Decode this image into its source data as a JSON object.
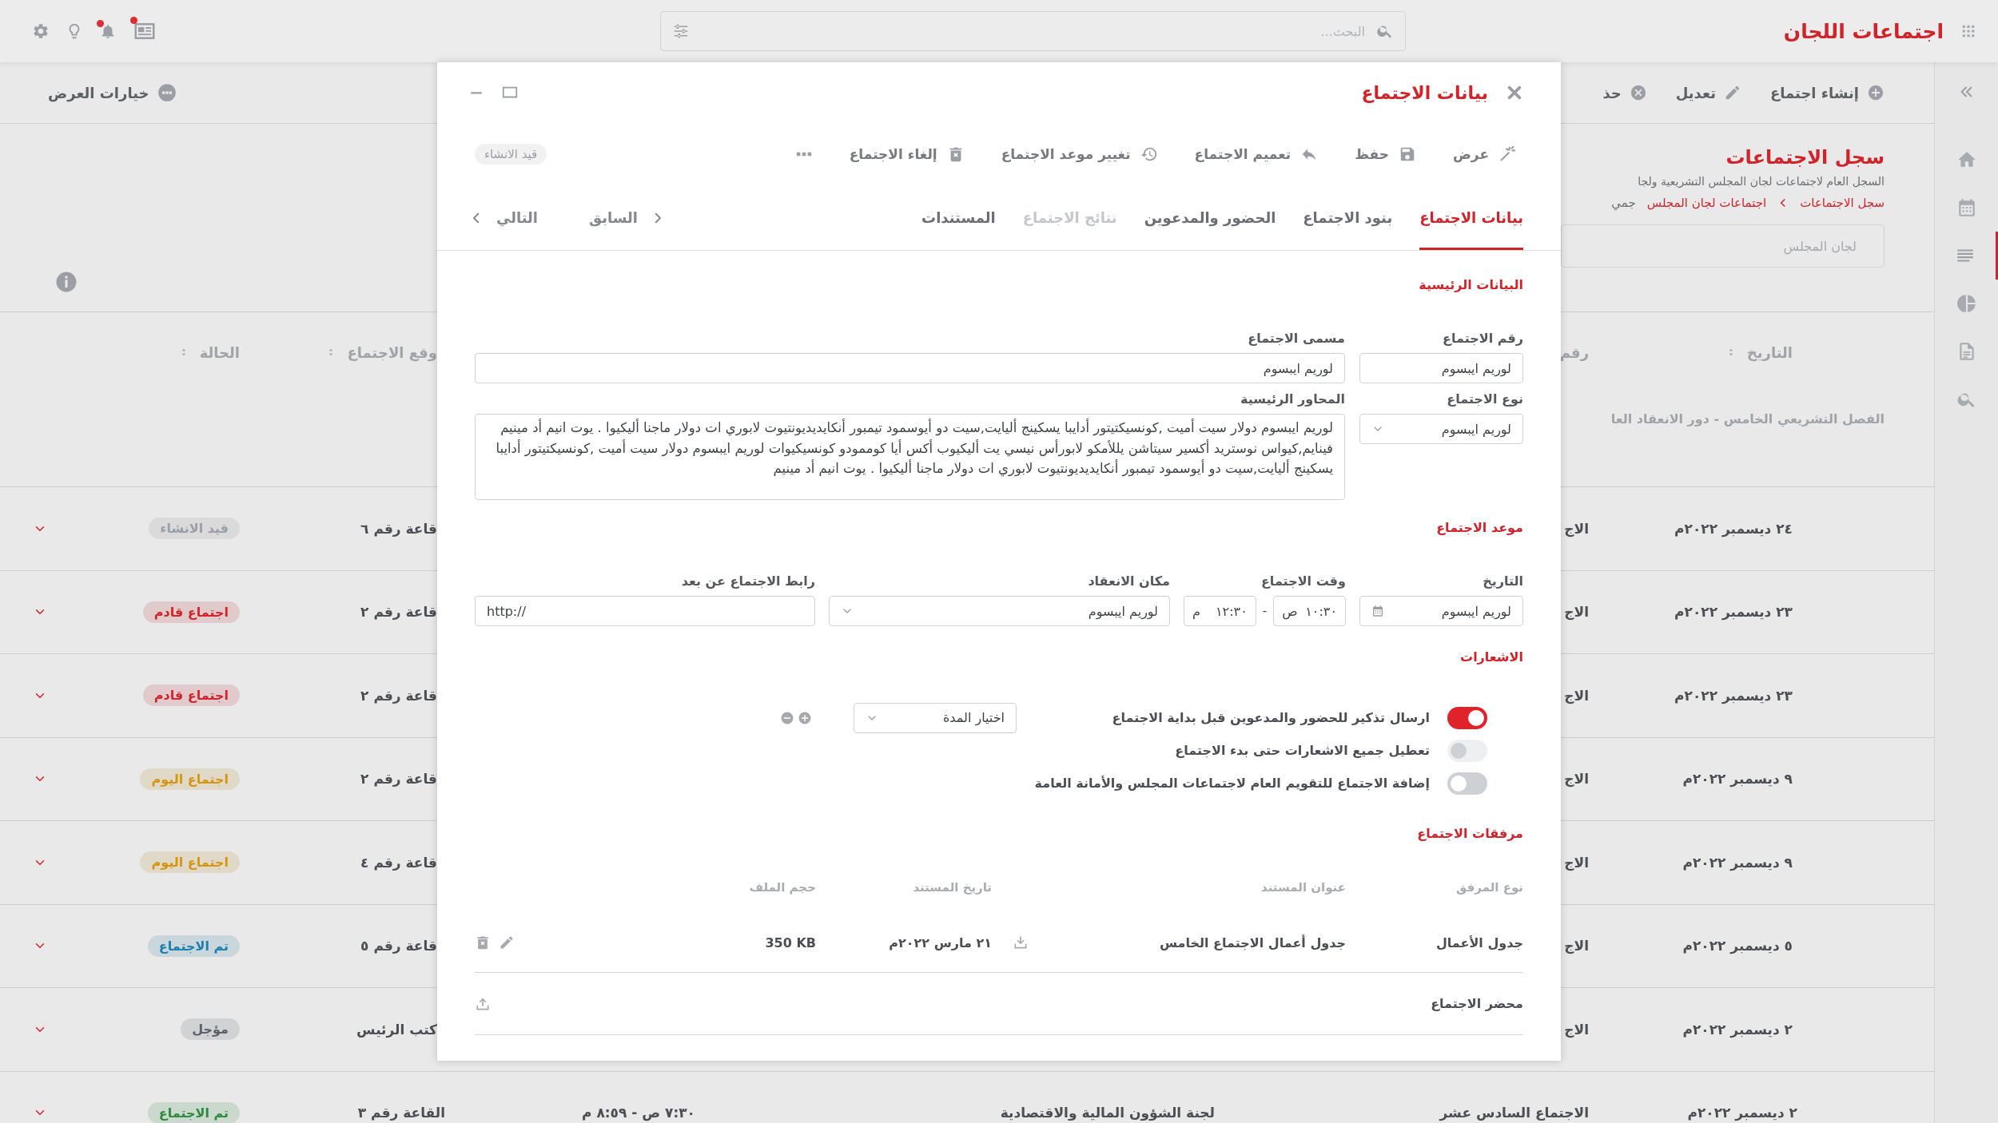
{
  "app": {
    "title": "اجتماعات اللجان"
  },
  "search": {
    "placeholder": "البحث..."
  },
  "top_icons": [
    {
      "kind": "news",
      "badge": true
    },
    {
      "kind": "bell",
      "badge": true
    },
    {
      "kind": "bulb",
      "badge": false
    },
    {
      "kind": "settings",
      "badge": false
    }
  ],
  "sidebar": {
    "items": [
      {
        "kind": "home",
        "selected": false
      },
      {
        "kind": "calendar",
        "selected": false
      },
      {
        "kind": "list",
        "selected": true
      },
      {
        "kind": "chart",
        "selected": false
      },
      {
        "kind": "document",
        "selected": false
      },
      {
        "kind": "search",
        "selected": false
      }
    ]
  },
  "toolbar": {
    "actions": [
      {
        "kind": "create",
        "label": "إنشاء اجتماع"
      },
      {
        "kind": "edit",
        "label": "تعديل"
      },
      {
        "kind": "delete",
        "label": "حذ"
      }
    ],
    "view_options": "خيارات العرض"
  },
  "page": {
    "title": "سجل الاجتماعات",
    "subtitle": "السجل العام لاجتماعات لجان المجلس التشريعية ولجا",
    "breadcrumb": [
      "سجل الاجتماعات",
      "اجتماعات لجان المجلس"
    ],
    "breadcrumb_extra": "جمي",
    "filter_placeholder": "لجان المجلس"
  },
  "table": {
    "columns_right": [
      "التاريخ",
      "رقم"
    ],
    "columns_left": [
      "وقع الاجتماع",
      "الحالة"
    ],
    "group": "الفصل التشريعي الخامس - دور الانعقاد العا",
    "rows": [
      {
        "date": "٢٤ ديسمبر ٢٠٢٢م",
        "number": "الاج",
        "location": "قاعة رقم ٦",
        "status": {
          "label": "قيد الانشاء",
          "color": "#9a9ea6"
        }
      },
      {
        "date": "٢٣ ديسمبر ٢٠٢٢م",
        "number": "الاج",
        "location": "قاعة رقم ٢",
        "status": {
          "label": "اجتماع قادم",
          "color": "#d0232a"
        }
      },
      {
        "date": "٢٣ ديسمبر ٢٠٢٢م",
        "number": "الاج",
        "location": "قاعة رقم ٢",
        "status": {
          "label": "اجتماع قادم",
          "color": "#d0232a"
        }
      },
      {
        "date": "٩ ديسمبر ٢٠٢٢م",
        "number": "الاج",
        "location": "قاعة رقم ٢",
        "status": {
          "label": "اجتماع اليوم",
          "color": "#d4960f"
        }
      },
      {
        "date": "٩ ديسمبر ٢٠٢٢م",
        "number": "الاج",
        "location": "قاعة رقم ٤",
        "status": {
          "label": "اجتماع اليوم",
          "color": "#d4960f"
        }
      },
      {
        "date": "٥ ديسمبر ٢٠٢٢م",
        "number": "الاج",
        "location": "قاعة رقم ٥",
        "status": {
          "label": "تم الاجتماع",
          "color": "#1a7fae"
        }
      },
      {
        "date": "٢ ديسمبر ٢٠٢٢م",
        "number": "الاج",
        "location": "كتب الرئيس",
        "status": {
          "label": "مؤجل",
          "color": "#5b6066"
        }
      }
    ],
    "last_row": {
      "date": "٢ ديسمبر ٢٠٢٢م",
      "title": "الاجتماع السادس عشر",
      "committee": "لجنة الشؤون المالية والاقتصادية",
      "time": "٧:٣٠ ص - ٨:٥٩ م",
      "location": "القاعة رقم ٣",
      "status": {
        "label": "تم الاجتماع",
        "color": "#2e8b3e"
      }
    }
  },
  "modal": {
    "title": "بيانات الاجتماع",
    "actions": [
      {
        "kind": "view",
        "label": "عرض"
      },
      {
        "kind": "save",
        "label": "حفظ"
      },
      {
        "kind": "share",
        "label": "تعميم الاجتماع"
      },
      {
        "kind": "reschedule",
        "label": "تغيير موعد الاجتماع"
      },
      {
        "kind": "cancel",
        "label": "إلغاء الاجتماع"
      }
    ],
    "status": "قيد الانشاء",
    "tabs": [
      {
        "label": "بيانات الاجتماع",
        "selected": true,
        "disabled": false
      },
      {
        "label": "بنود الاجتماع",
        "selected": false,
        "disabled": false
      },
      {
        "label": "الحضور والمدعوين",
        "selected": false,
        "disabled": false
      },
      {
        "label": "نتائج الاجتماع",
        "selected": false,
        "disabled": true
      },
      {
        "label": "المستندات",
        "selected": false,
        "disabled": false
      }
    ],
    "prev": "السابق",
    "next": "التالي",
    "main": {
      "title": "البيانات الرئيسية",
      "number": {
        "label": "رقم الاجتماع",
        "value": "لوريم ايبسوم"
      },
      "name": {
        "label": "مسمى الاجتماع",
        "value": "لوريم ايبسوم"
      },
      "type": {
        "label": "نوع الاجتماع",
        "value": "لوريم ايبسوم"
      },
      "topics": {
        "label": "المحاور الرئيسية",
        "value": "لوريم ايبسوم دولار سيت أميت ,كونسيكتيتور أدايبا يسكينج أليايت,سيت دو أيوسمود تيمبور أنكايديديونتيوت لابوري ات دولار ماجنا أليكيوا . يوت انيم أد مينيم فينايم,كيواس نوستريد أكسير سيتاشن يللأمكو لابورأس نيسي يت أليكيوب أكس أيا كوممودو كونسيكيوات لوريم ايبسوم دولار سيت أميت ,كونسيكتيتور أدايبا يسكينج أليايت,سيت دو أيوسمود تيمبور أنكايديديونتيوت لابوري ات دولار ماجنا أليكيوا . يوت انيم أد مينيم"
      }
    },
    "schedule": {
      "title": "موعد الاجتماع",
      "date": {
        "label": "التاريخ",
        "value": "لوريم ايبسوم"
      },
      "time": {
        "label": "وقت الاجتماع",
        "from": "١٠:٣٠",
        "from_period": "ص",
        "separator": "-",
        "to": "١٢:٣٠",
        "to_period": "م"
      },
      "place": {
        "label": "مكان الانعقاد",
        "value": "لوريم ايبسوم"
      },
      "link": {
        "label": "رابط الاجتماع عن بعد",
        "value": "http://"
      }
    },
    "notifications": {
      "title": "الاشعارات",
      "items": [
        {
          "label": "ارسال تذكير للحضور والمدعوين قبل بداية الاجتماع",
          "on": true,
          "disabled": false,
          "duration_placeholder": "اختيار المدة"
        },
        {
          "label": "تعطيل جميع الاشعارات حتى بدء الاجتماع",
          "on": false,
          "disabled": true
        },
        {
          "label": "إضافة الاجتماع للتقويم العام لاجتماعات المجلس والأمانة العامة",
          "on": false,
          "disabled": false
        }
      ]
    },
    "attachments": {
      "title": "مرفقات الاجتماع",
      "columns": [
        "نوع المرفق",
        "عنوان المستند",
        "تاريخ المستند",
        "حجم الملف"
      ],
      "rows": [
        {
          "kind": "file",
          "type": "جدول الأعمال",
          "title": "جدول أعمال الاجتماع الخامس",
          "date": "٢١ مارس ٢٠٢٢م",
          "size": "350 KB"
        },
        {
          "kind": "empty",
          "type": "محضر الاجتماع"
        }
      ]
    }
  }
}
